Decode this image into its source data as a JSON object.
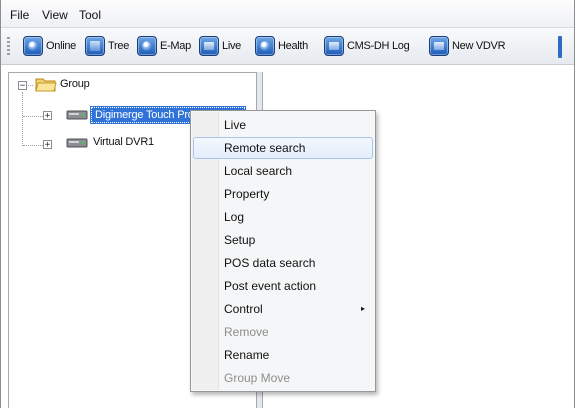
{
  "menu": {
    "file": "File",
    "view": "View",
    "tool": "Tool"
  },
  "toolbar": {
    "online": "Online",
    "tree": "Tree",
    "emap": "E-Map",
    "live": "Live",
    "health": "Health",
    "cms_log": "CMS-DH Log",
    "new_vdvr": "New VDVR"
  },
  "tree": {
    "root": "Group",
    "expander_root": "−",
    "expander_child": "+",
    "selected_label": "Digimerge Touch Pro DVR1",
    "second_label": "Virtual DVR1"
  },
  "context_menu": {
    "items": [
      {
        "label": "Live"
      },
      {
        "label": "Remote search"
      },
      {
        "label": "Local search"
      },
      {
        "label": "Property"
      },
      {
        "label": "Log"
      },
      {
        "label": "Setup"
      },
      {
        "label": "POS data search"
      },
      {
        "label": "Post event action"
      },
      {
        "label": "Control"
      },
      {
        "label": "Remove"
      },
      {
        "label": "Rename"
      },
      {
        "label": "Group Move"
      }
    ],
    "highlighted": "Remote search",
    "disabled": [
      "Remove",
      "Group Move"
    ],
    "submenu_indicator": "▸"
  },
  "colors": {
    "selection": "#2f73d9",
    "menu_highlight_border": "#a8c6ec",
    "toolbar_icon": "#1e5db7"
  }
}
